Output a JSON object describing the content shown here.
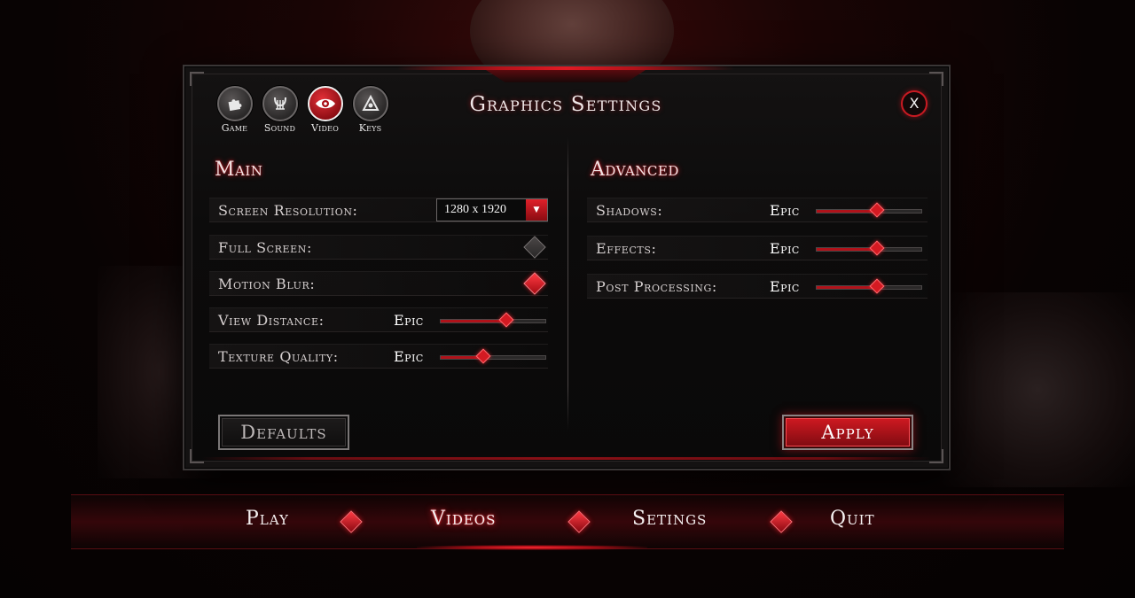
{
  "panel": {
    "title": "Graphics Settings",
    "close_label": "X"
  },
  "tabs": [
    {
      "label": "Game",
      "icon": "puzzle-icon",
      "active": false
    },
    {
      "label": "Sound",
      "icon": "lyre-icon",
      "active": false
    },
    {
      "label": "Video",
      "icon": "eye-icon",
      "active": true
    },
    {
      "label": "Keys",
      "icon": "triangle-key-icon",
      "active": false
    }
  ],
  "main": {
    "title": "Main",
    "screen_resolution": {
      "label": "Screen Resolution:",
      "value": "1280 x 1920"
    },
    "full_screen": {
      "label": "Full Screen:",
      "checked": false
    },
    "motion_blur": {
      "label": "Motion Blur:",
      "checked": true
    },
    "view_distance": {
      "label": "View Distance:",
      "value": "Epic",
      "level": 0.63
    },
    "texture_quality": {
      "label": "Texture Quality:",
      "value": "Epic",
      "level": 0.41
    }
  },
  "advanced": {
    "title": "Advanced",
    "shadows": {
      "label": "Shadows:",
      "value": "Epic",
      "level": 0.58
    },
    "effects": {
      "label": "Effects:",
      "value": "Epic",
      "level": 0.58
    },
    "post_processing": {
      "label": "Post Processing:",
      "value": "Epic",
      "level": 0.58
    }
  },
  "buttons": {
    "defaults": "Defaults",
    "apply": "Apply"
  },
  "nav": {
    "items": [
      "Play",
      "Videos",
      "Setings",
      "Quit"
    ],
    "active": "Videos"
  },
  "colors": {
    "accent": "#d41a22",
    "accent_dark": "#8a0c12",
    "panel_bg": "#0c0b0b",
    "text": "#e8e2e2"
  }
}
